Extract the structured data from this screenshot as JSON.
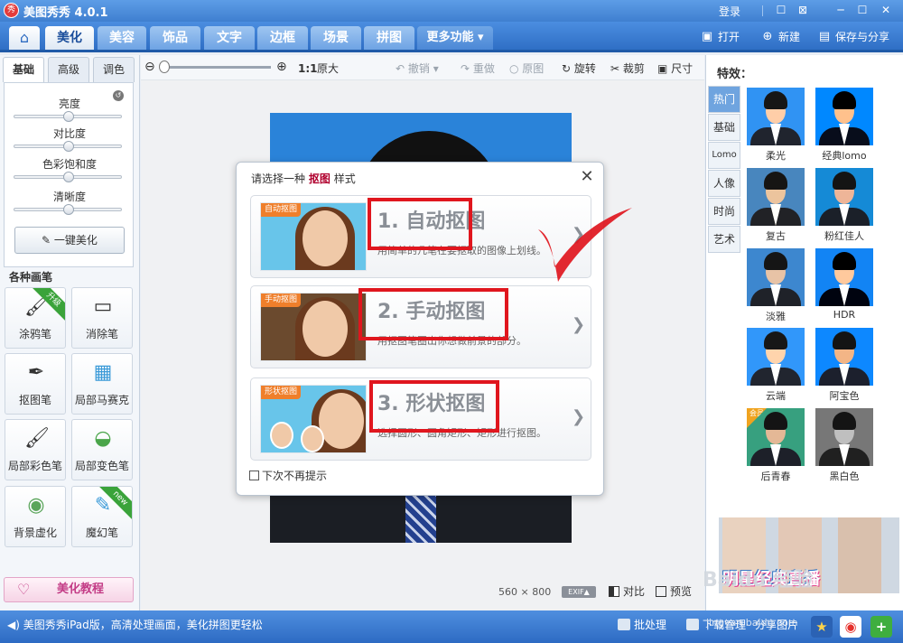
{
  "app": {
    "logo_glyph": "秀",
    "title": "美图秀秀 4.0.1",
    "login": "登录",
    "controls": [
      "☐",
      "⊠",
      "─",
      "☐",
      "✕"
    ]
  },
  "nav": {
    "home_icon": "home-icon",
    "tabs": [
      "美化",
      "美容",
      "饰品",
      "文字",
      "边框",
      "场景",
      "拼图",
      "更多功能 ▾"
    ],
    "active_tab": "美化",
    "actions": {
      "open": "打开",
      "new": "新建",
      "save_share": "保存与分享"
    }
  },
  "left_panel": {
    "tabs": [
      "基础",
      "高级",
      "调色"
    ],
    "sliders": [
      {
        "label": "亮度",
        "value": 0.5
      },
      {
        "label": "对比度",
        "value": 0.5
      },
      {
        "label": "色彩饱和度",
        "value": 0.5
      },
      {
        "label": "清晰度",
        "value": 0.5
      }
    ],
    "one_key": "一键美化",
    "brushes_title": "各种画笔",
    "tools": [
      {
        "label": "涂鸦笔",
        "glyph": "🖌",
        "ribbon": "升级"
      },
      {
        "label": "消除笔",
        "glyph": "▭",
        "ribbon": ""
      },
      {
        "label": "抠图笔",
        "glyph": "✒",
        "ribbon": ""
      },
      {
        "label": "局部马赛克",
        "glyph": "▦",
        "ribbon": ""
      },
      {
        "label": "局部彩色笔",
        "glyph": "🖌",
        "ribbon": ""
      },
      {
        "label": "局部变色笔",
        "glyph": "◒",
        "ribbon": ""
      },
      {
        "label": "背景虚化",
        "glyph": "◉",
        "ribbon": ""
      },
      {
        "label": "魔幻笔",
        "glyph": "✎",
        "ribbon": "new"
      }
    ],
    "tutorial": "美化教程"
  },
  "toolbar": {
    "zoom_out": "⊖",
    "zoom_in": "⊕",
    "ratio": "1:1",
    "original_size": "原大",
    "undo": "撤销",
    "redo": "重做",
    "original": "原图",
    "rotate": "旋转",
    "crop": "裁剪",
    "size": "尺寸"
  },
  "image_info": {
    "width": "560",
    "times": "×",
    "height": "800",
    "exif": "EXIF▲",
    "compare": "对比",
    "preview": "预览"
  },
  "dialog": {
    "title_prefix": "请选择一种",
    "title_bold": "抠图",
    "title_suffix": "样式",
    "close": "✕",
    "options": [
      {
        "tag": "自动抠图",
        "title": "1. 自动抠图",
        "desc": "用简单的几笔在要抠取的图像上划线。"
      },
      {
        "tag": "手动抠图",
        "title": "2. 手动抠图",
        "desc": "用抠图笔圈出你想做前景的部分。"
      },
      {
        "tag": "形状抠图",
        "title": "3. 形状抠图",
        "desc": "选择圆形、圆角矩形、矩形进行抠图。"
      }
    ],
    "dont_show": "下次不再提示",
    "highlight_color": "#e0161e"
  },
  "effects": {
    "title": "特效：",
    "tabs": [
      "热门",
      "基础",
      "Lomo",
      "人像",
      "时尚",
      "艺术"
    ],
    "active_tab": "热门",
    "items": [
      "柔光",
      "经典lomo",
      "复古",
      "粉红佳人",
      "淡雅",
      "HDR",
      "云端",
      "阿宝色",
      "后青春",
      "黑白色"
    ],
    "member_badge": "会员",
    "banner_text": "明星经典直播"
  },
  "watermark": {
    "text": "Baidu 经验",
    "url": "jingyan.baidu.com"
  },
  "status": {
    "message": "美图秀秀iPad版，高清处理画面，美化拼图更轻松",
    "batch": "批处理",
    "download": "下载管理",
    "share": "分享图片"
  },
  "colors": {
    "accent": "#2f6fc5",
    "checkmark": "#e0161e",
    "photo_bg": "#2a83d9"
  }
}
